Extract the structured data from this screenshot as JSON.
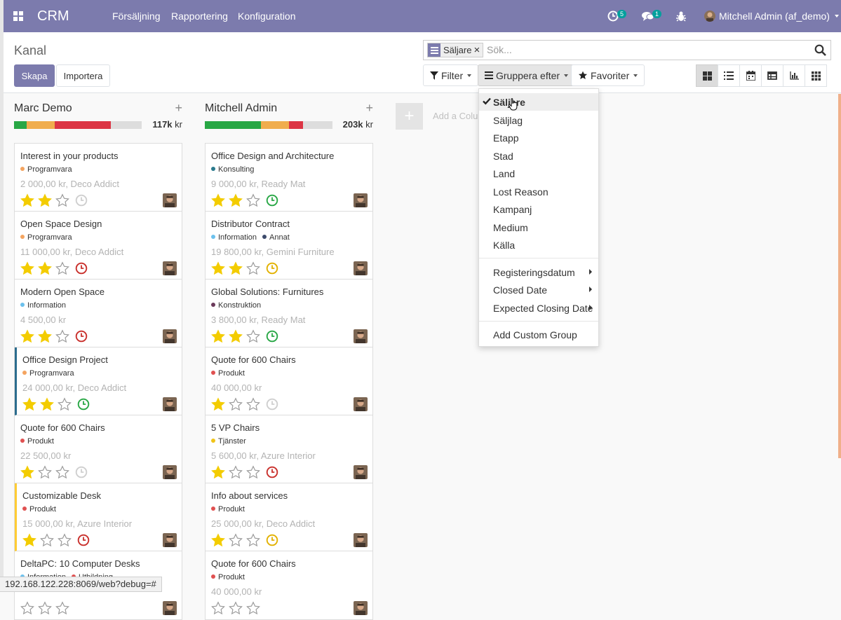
{
  "navbar": {
    "brand": "CRM",
    "menus": [
      "Försäljning",
      "Rapportering",
      "Konfiguration"
    ],
    "activity_count": "5",
    "message_count": "1",
    "user": "Mitchell Admin (af_demo)"
  },
  "control": {
    "breadcrumb": "Kanal",
    "create_label": "Skapa",
    "import_label": "Importera",
    "facet_label": "Säljare",
    "facet_remove": "×",
    "search_placeholder": "Sök...",
    "filter_label": "Filter",
    "groupby_label": "Gruppera efter",
    "favorites_label": "Favoriter",
    "views": [
      "kanban-icon",
      "list-icon",
      "calendar-icon",
      "pivot-icon",
      "graph-icon",
      "activity-icon"
    ]
  },
  "groupby_menu": {
    "items": [
      "Säljare",
      "Säljlag",
      "Etapp",
      "Stad",
      "Land",
      "Lost Reason",
      "Kampanj",
      "Medium",
      "Källa"
    ],
    "date_items": [
      "Registeringsdatum",
      "Closed Date",
      "Expected Closing Date"
    ],
    "custom": "Add Custom Group"
  },
  "kanban": {
    "add_column_label": "Add a Column",
    "columns": [
      {
        "title": "Marc Demo",
        "total": "117k",
        "currency": "kr",
        "progress": [
          {
            "color": "#28a745",
            "pct": 10
          },
          {
            "color": "#f0ad4e",
            "pct": 22
          },
          {
            "color": "#dc3545",
            "pct": 44
          },
          {
            "color": "#dddddd",
            "pct": 24
          }
        ],
        "cards": [
          {
            "title": "Interest in your products",
            "tags": [
              {
                "name": "Programvara",
                "color": "#f4a460"
              }
            ],
            "sub": "2 000,00 kr, Deco Addict",
            "stars": 2,
            "clock": "#cfcfcf",
            "edge": ""
          },
          {
            "title": "Open Space Design",
            "tags": [
              {
                "name": "Programvara",
                "color": "#f4a460"
              }
            ],
            "sub": "11 000,00 kr, Deco Addict",
            "stars": 2,
            "clock": "#c9302c",
            "edge": ""
          },
          {
            "title": "Modern Open Space",
            "tags": [
              {
                "name": "Information",
                "color": "#6cc1ed"
              }
            ],
            "sub": "4 500,00 kr",
            "stars": 2,
            "clock": "#c9302c",
            "edge": ""
          },
          {
            "title": "Office Design Project",
            "tags": [
              {
                "name": "Programvara",
                "color": "#f4a460"
              }
            ],
            "sub": "24 000,00 kr, Deco Addict",
            "stars": 2,
            "clock": "#28a745",
            "edge": "blue"
          },
          {
            "title": "Quote for 600 Chairs",
            "tags": [
              {
                "name": "Produkt",
                "color": "#e05151"
              }
            ],
            "sub": "22 500,00 kr",
            "stars": 1,
            "clock": "#cfcfcf",
            "edge": ""
          },
          {
            "title": "Customizable Desk",
            "tags": [
              {
                "name": "Produkt",
                "color": "#e05151"
              }
            ],
            "sub": "15 000,00 kr, Azure Interior",
            "stars": 1,
            "clock": "#c9302c",
            "edge": "yellow"
          },
          {
            "title": "DeltaPC: 10 Computer Desks",
            "tags": [
              {
                "name": "Information",
                "color": "#6cc1ed"
              },
              {
                "name": "Utbildning",
                "color": "#e05151"
              }
            ],
            "sub": "",
            "stars": 0,
            "clock": "",
            "edge": ""
          }
        ]
      },
      {
        "title": "Mitchell Admin",
        "total": "203k",
        "currency": "kr",
        "progress": [
          {
            "color": "#28a745",
            "pct": 44
          },
          {
            "color": "#f0ad4e",
            "pct": 22
          },
          {
            "color": "#dc3545",
            "pct": 11
          },
          {
            "color": "#dddddd",
            "pct": 23
          }
        ],
        "cards": [
          {
            "title": "Office Design and Architecture",
            "tags": [
              {
                "name": "Konsulting",
                "color": "#2b7a8d"
              }
            ],
            "sub": "9 000,00 kr, Ready Mat",
            "stars": 2,
            "clock": "#28a745",
            "edge": ""
          },
          {
            "title": "Distributor Contract",
            "tags": [
              {
                "name": "Information",
                "color": "#6cc1ed"
              },
              {
                "name": "Annat",
                "color": "#3c4a6b"
              }
            ],
            "sub": "19 800,00 kr, Gemini Furniture",
            "stars": 2,
            "clock": "#e2b100",
            "edge": ""
          },
          {
            "title": "Global Solutions: Furnitures",
            "tags": [
              {
                "name": "Konstruktion",
                "color": "#6b3a5b"
              }
            ],
            "sub": "3 800,00 kr, Ready Mat",
            "stars": 2,
            "clock": "#28a745",
            "edge": ""
          },
          {
            "title": "Quote for 600 Chairs",
            "tags": [
              {
                "name": "Produkt",
                "color": "#e05151"
              }
            ],
            "sub": "40 000,00 kr",
            "stars": 1,
            "clock": "#cfcfcf",
            "edge": ""
          },
          {
            "title": "5 VP Chairs",
            "tags": [
              {
                "name": "Tjänster",
                "color": "#f0c419"
              }
            ],
            "sub": "5 600,00 kr, Azure Interior",
            "stars": 1,
            "clock": "#c9302c",
            "edge": ""
          },
          {
            "title": "Info about services",
            "tags": [
              {
                "name": "Produkt",
                "color": "#e05151"
              }
            ],
            "sub": "25 000,00 kr, Deco Addict",
            "stars": 1,
            "clock": "#e2b100",
            "edge": ""
          },
          {
            "title": "Quote for 600 Chairs",
            "tags": [
              {
                "name": "Produkt",
                "color": "#e05151"
              }
            ],
            "sub": "40 000,00 kr",
            "stars": 0,
            "clock": "",
            "edge": ""
          }
        ]
      }
    ]
  },
  "statusbar": "192.168.122.228:8069/web?debug=#"
}
